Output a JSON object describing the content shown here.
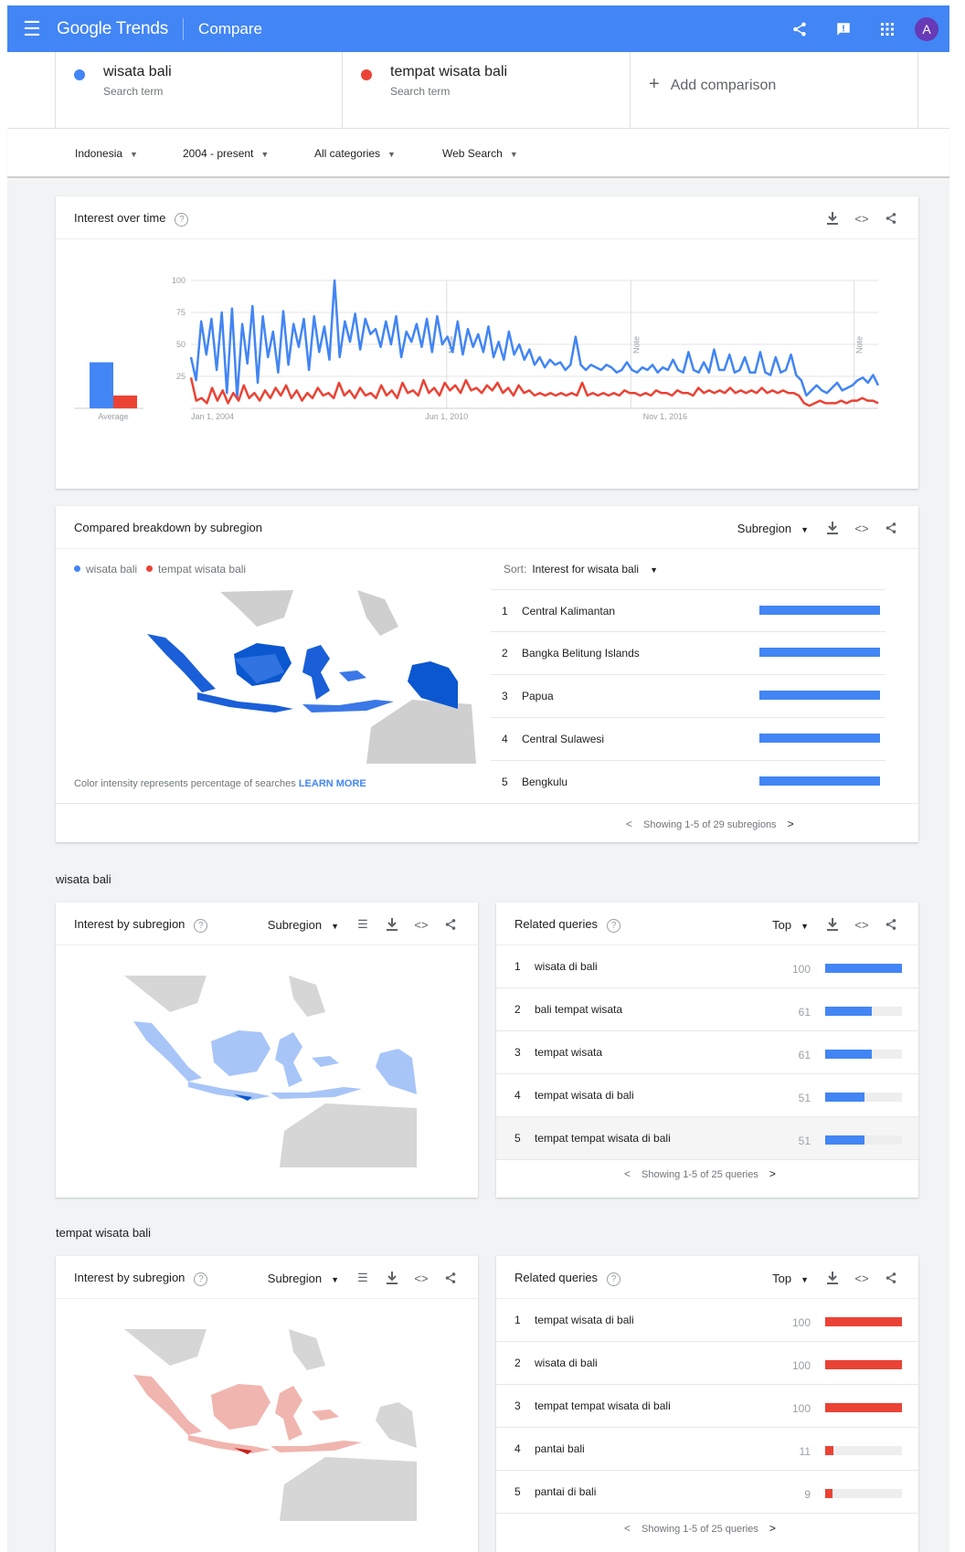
{
  "header": {
    "app_name": "Google Trends",
    "page": "Compare",
    "avatar_letter": "A"
  },
  "terms": [
    {
      "name": "wisata bali",
      "type": "Search term",
      "color": "#4285f4"
    },
    {
      "name": "tempat wisata bali",
      "type": "Search term",
      "color": "#ea4335"
    }
  ],
  "add_comparison": "Add comparison",
  "filters": {
    "region": "Indonesia",
    "time": "2004 - present",
    "category": "All categories",
    "property": "Web Search"
  },
  "interest_over_time": {
    "title": "Interest over time",
    "average_label": "Average",
    "y_ticks": [
      "100",
      "75",
      "50",
      "25"
    ],
    "x_labels": [
      "Jan 1, 2004",
      "Jun 1, 2010",
      "Nov 1, 2016"
    ],
    "note_label": "Note"
  },
  "chart_data": {
    "type": "line",
    "title": "Interest over time",
    "ylim": [
      0,
      100
    ],
    "series": [
      {
        "name": "wisata bali",
        "color": "#4285f4",
        "average": 36,
        "values": [
          40,
          22,
          68,
          42,
          70,
          30,
          75,
          12,
          78,
          8,
          66,
          35,
          80,
          20,
          72,
          40,
          60,
          28,
          76,
          34,
          66,
          48,
          70,
          30,
          72,
          44,
          64,
          38,
          100,
          40,
          68,
          52,
          74,
          46,
          70,
          58,
          62,
          48,
          68,
          50,
          72,
          40,
          60,
          52,
          66,
          48,
          70,
          44,
          72,
          50,
          56,
          44,
          68,
          42,
          62,
          48,
          58,
          44,
          64,
          40,
          52,
          38,
          60,
          42,
          50,
          38,
          46,
          34,
          40,
          32,
          38,
          34,
          36,
          30,
          34,
          56,
          34,
          30,
          34,
          32,
          30,
          34,
          32,
          28,
          30,
          36,
          30,
          28,
          32,
          30,
          34,
          28,
          32,
          30,
          38,
          30,
          28,
          44,
          30,
          28,
          36,
          28,
          46,
          30,
          30,
          42,
          28,
          30,
          40,
          28,
          28,
          44,
          28,
          26,
          40,
          28,
          30,
          42,
          26,
          22,
          10,
          14,
          18,
          14,
          12,
          16,
          20,
          14,
          16,
          18,
          22,
          24,
          20,
          26,
          18
        ]
      },
      {
        "name": "tempat wisata bali",
        "color": "#ea4335",
        "average": 10,
        "values": [
          24,
          6,
          8,
          4,
          16,
          6,
          14,
          4,
          12,
          6,
          18,
          8,
          12,
          6,
          14,
          8,
          16,
          10,
          18,
          8,
          14,
          6,
          12,
          8,
          16,
          10,
          12,
          8,
          20,
          10,
          14,
          8,
          16,
          10,
          12,
          8,
          18,
          10,
          14,
          8,
          20,
          12,
          14,
          10,
          22,
          12,
          16,
          10,
          20,
          14,
          18,
          12,
          22,
          14,
          16,
          12,
          18,
          14,
          20,
          12,
          16,
          10,
          18,
          12,
          14,
          10,
          12,
          10,
          12,
          10,
          12,
          10,
          12,
          10,
          20,
          10,
          12,
          10,
          12,
          10,
          12,
          10,
          14,
          12,
          12,
          10,
          12,
          10,
          14,
          12,
          12,
          10,
          14,
          12,
          12,
          10,
          16,
          12,
          14,
          12,
          14,
          12,
          16,
          12,
          14,
          12,
          14,
          12,
          16,
          12,
          14,
          12,
          14,
          12,
          12,
          10,
          4,
          2,
          4,
          6,
          4,
          4,
          4,
          6,
          4,
          6,
          6,
          8,
          6,
          6,
          4
        ]
      }
    ]
  },
  "subregion_breakdown": {
    "title": "Compared breakdown by subregion",
    "dropdown": "Subregion",
    "legend": [
      "wisata bali",
      "tempat wisata bali"
    ],
    "sort_label": "Sort:",
    "sort_value": "Interest for wisata bali",
    "rows": [
      {
        "rank": "1",
        "name": "Central Kalimantan"
      },
      {
        "rank": "2",
        "name": "Bangka Belitung Islands"
      },
      {
        "rank": "3",
        "name": "Papua"
      },
      {
        "rank": "4",
        "name": "Central Sulawesi"
      },
      {
        "rank": "5",
        "name": "Bengkulu"
      }
    ],
    "note": "Color intensity represents percentage of searches",
    "learn_more": "LEARN MORE",
    "pager": "Showing 1-5 of 29 subregions"
  },
  "section_wisata": {
    "label": "wisata bali",
    "interest_title": "Interest by subregion",
    "dropdown": "Subregion",
    "related_title": "Related queries",
    "related_dropdown": "Top",
    "queries": [
      {
        "rank": "1",
        "text": "wisata di bali",
        "value": "100",
        "pct": 100
      },
      {
        "rank": "2",
        "text": "bali tempat wisata",
        "value": "61",
        "pct": 61
      },
      {
        "rank": "3",
        "text": "tempat wisata",
        "value": "61",
        "pct": 61
      },
      {
        "rank": "4",
        "text": "tempat wisata di bali",
        "value": "51",
        "pct": 51
      },
      {
        "rank": "5",
        "text": "tempat tempat wisata di bali",
        "value": "51",
        "pct": 51
      }
    ],
    "pager": "Showing 1-5 of 25 queries",
    "color": "#4285f4"
  },
  "section_tempat": {
    "label": "tempat wisata bali",
    "interest_title": "Interest by subregion",
    "dropdown": "Subregion",
    "related_title": "Related queries",
    "related_dropdown": "Top",
    "queries": [
      {
        "rank": "1",
        "text": "tempat wisata di bali",
        "value": "100",
        "pct": 100
      },
      {
        "rank": "2",
        "text": "wisata di bali",
        "value": "100",
        "pct": 100
      },
      {
        "rank": "3",
        "text": "tempat tempat wisata di bali",
        "value": "100",
        "pct": 100
      },
      {
        "rank": "4",
        "text": "pantai bali",
        "value": "11",
        "pct": 11
      },
      {
        "rank": "5",
        "text": "pantai di bali",
        "value": "9",
        "pct": 9
      }
    ],
    "pager": "Showing 1-5 of 25 queries",
    "color": "#ea4335"
  }
}
